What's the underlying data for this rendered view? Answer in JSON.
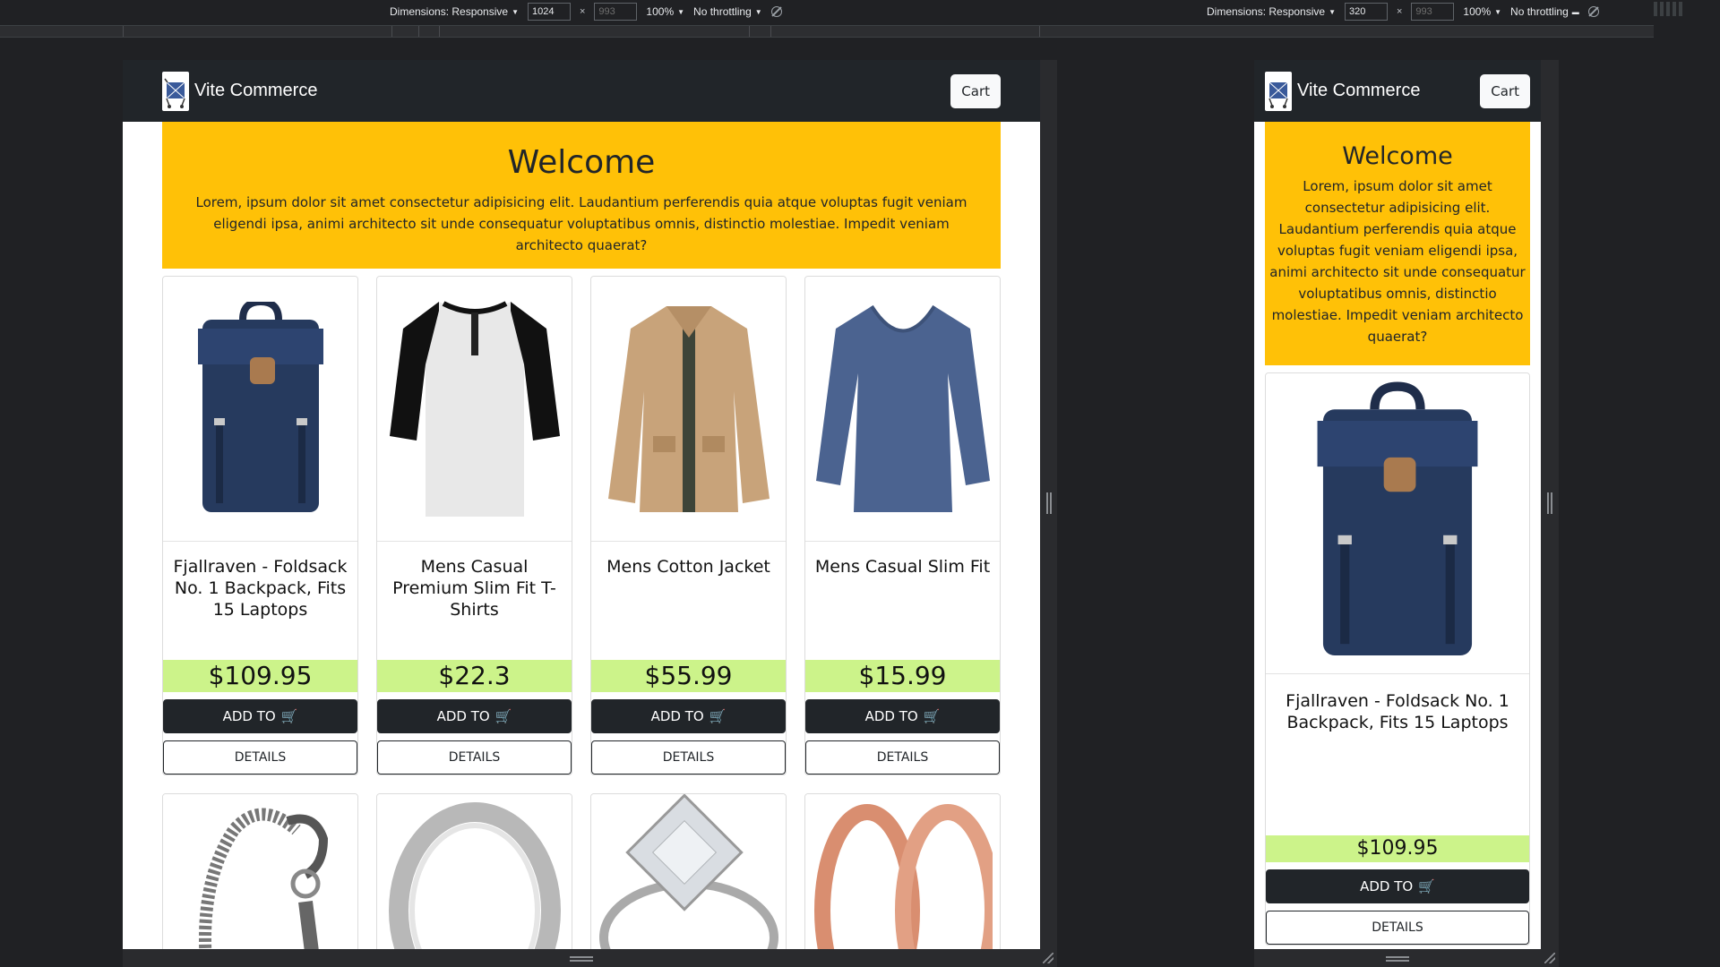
{
  "devtools": {
    "left": {
      "dimensions_label": "Dimensions: Responsive",
      "width": "1024",
      "height": "993",
      "zoom": "100%",
      "throttling": "No throttling"
    },
    "right": {
      "dimensions_label": "Dimensions: Responsive",
      "width": "320",
      "height": "993",
      "zoom": "100%",
      "throttling": "No throttling"
    }
  },
  "site": {
    "brand": "Vite Commerce",
    "cart_label": "Cart",
    "hero": {
      "title": "Welcome",
      "text": "Lorem, ipsum dolor sit amet consectetur adipisicing elit. Laudantium perferendis quia atque voluptas fugit veniam eligendi ipsa, animi architecto sit unde consequatur voluptatibus omnis, distinctio molestiae. Impedit veniam architecto quaerat?"
    },
    "add_label": "ADD TO",
    "details_label": "DETAILS",
    "products": [
      {
        "title": "Fjallraven - Foldsack No. 1 Backpack, Fits 15 Laptops",
        "price": "$109.95",
        "image": "backpack-image"
      },
      {
        "title": "Mens Casual Premium Slim Fit T-Shirts",
        "price": "$22.3",
        "image": "raglan-tshirt-image"
      },
      {
        "title": "Mens Cotton Jacket",
        "price": "$55.99",
        "image": "cotton-jacket-image"
      },
      {
        "title": "Mens Casual Slim Fit",
        "price": "$15.99",
        "image": "longsleeve-shirt-image"
      }
    ],
    "products_row2": [
      {
        "image": "dragon-bracelet-image"
      },
      {
        "image": "silver-ring-image"
      },
      {
        "image": "diamond-ring-image"
      },
      {
        "image": "rose-gold-rings-image"
      }
    ]
  },
  "colors": {
    "navbar": "#212529",
    "hero": "#ffc107",
    "price": "#ccf38a",
    "cart_icon": "#28c840"
  }
}
